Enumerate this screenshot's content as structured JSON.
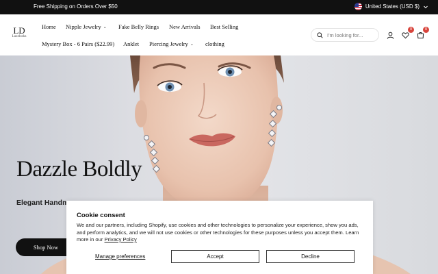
{
  "announcement": {
    "promo_text": "Free Shipping on Orders Over $50",
    "region_label": "United States (USD $)"
  },
  "header": {
    "logo_mark": "LD",
    "logo_word": "Luxelocks",
    "nav": [
      {
        "label": "Home",
        "has_dropdown": false
      },
      {
        "label": "Nipple Jewelry",
        "has_dropdown": true
      },
      {
        "label": "Fake Belly Rings",
        "has_dropdown": false
      },
      {
        "label": "New Arrivals",
        "has_dropdown": false
      },
      {
        "label": "Best Selling",
        "has_dropdown": false
      },
      {
        "label": "Mystery Box - 6 Pairs ($22.99)",
        "has_dropdown": false
      },
      {
        "label": "Anklet",
        "has_dropdown": false
      },
      {
        "label": "Piercing Jewelry",
        "has_dropdown": true
      },
      {
        "label": "clothing",
        "has_dropdown": false
      }
    ],
    "search_placeholder": "I'm looking for...",
    "wishlist_count": "0",
    "cart_count": "0",
    "icons": [
      "search-icon",
      "account-icon",
      "heart-icon",
      "cart-icon"
    ]
  },
  "hero": {
    "title": "Dazzle Boldly",
    "subtitle": "Elegant Handmade",
    "cta_label": "Shop Now"
  },
  "cookie": {
    "title": "Cookie consent",
    "body": "We and our partners, including Shopify, use cookies and other technologies to personalize your experience, show you ads, and perform analytics, and we will not use cookies or other technologies for these purposes unless you accept them. Learn more in our ",
    "policy_link": "Privacy Policy",
    "manage_label": "Manage preferences",
    "accept_label": "Accept",
    "decline_label": "Decline"
  },
  "colors": {
    "topbar_bg": "#111111",
    "badge": "#d8443c",
    "cta_bg": "#111111"
  }
}
